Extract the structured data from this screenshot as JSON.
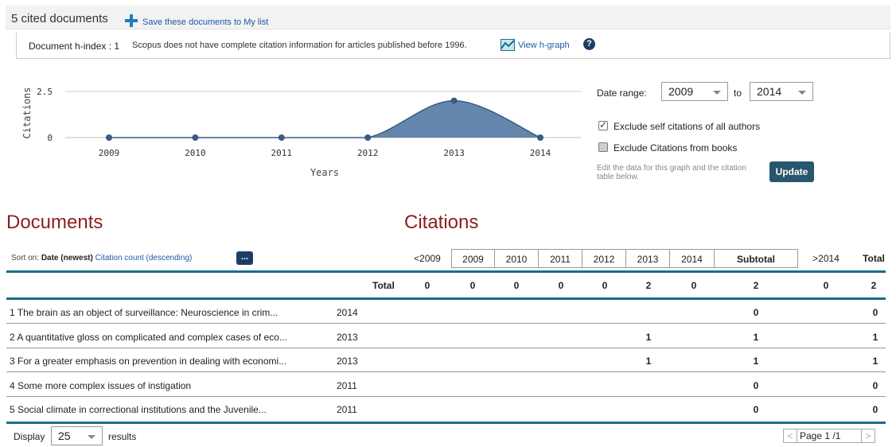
{
  "header": {
    "title": "5 cited documents",
    "save_label": "Save these documents to My list",
    "hindex_label": "Document h-index : 1",
    "hindex_note": "Scopus does not have complete citation information for articles published before 1996.",
    "view_hgraph": "View h-graph",
    "help": "?"
  },
  "chart_data": {
    "type": "area",
    "x": [
      "2009",
      "2010",
      "2011",
      "2012",
      "2013",
      "2014"
    ],
    "series": [
      {
        "values": [
          0,
          0,
          0,
          0,
          2,
          0
        ]
      }
    ],
    "xlabel": "Years",
    "ylabel": "Citations",
    "yticks": [
      "2.5",
      "0"
    ],
    "ylim": [
      0,
      2.5
    ],
    "fill_color": "#5d7fa8",
    "line_color": "#3b5a86"
  },
  "controls": {
    "date_range_label": "Date range:",
    "from_year": "2009",
    "to_label": "to",
    "to_year": "2014",
    "exclude_self_label": "Exclude self citations of all authors",
    "exclude_self_checked": true,
    "exclude_books_label": "Exclude Citations from books",
    "exclude_books_checked": false,
    "edit_note": "Edit the data for this graph and the citation table below.",
    "update_label": "Update"
  },
  "sections": {
    "documents": "Documents",
    "citations": "Citations"
  },
  "sort": {
    "prefix": "Sort on:",
    "current": "Date (newest)",
    "option": "Citation count (descending)",
    "more": "..."
  },
  "table": {
    "columns": [
      "<2009",
      "2009",
      "2010",
      "2011",
      "2012",
      "2013",
      "2014",
      "Subtotal",
      ">2014",
      "Total"
    ],
    "totals_label": "Total",
    "totals": [
      "0",
      "0",
      "0",
      "0",
      "0",
      "2",
      "0",
      "2",
      "0",
      "2"
    ],
    "rows": [
      {
        "title": "1 The brain as an object of surveillance: Neuroscience in crim...",
        "year": "2014",
        "cells": [
          "",
          "",
          "",
          "",
          "",
          "",
          "",
          "0",
          "",
          "0"
        ]
      },
      {
        "title": "2 A quantitative gloss on complicated and complex cases of eco...",
        "year": "2013",
        "cells": [
          "",
          "",
          "",
          "",
          "",
          "1",
          "",
          "1",
          "",
          "1"
        ]
      },
      {
        "title": "3 For a greater emphasis on prevention in dealing with economi...",
        "year": "2013",
        "cells": [
          "",
          "",
          "",
          "",
          "",
          "1",
          "",
          "1",
          "",
          "1"
        ]
      },
      {
        "title": "4 Some more complex issues of instigation",
        "year": "2011",
        "cells": [
          "",
          "",
          "",
          "",
          "",
          "",
          "",
          "0",
          "",
          "0"
        ]
      },
      {
        "title": "5 Social climate in correctional institutions and the Juvenile...",
        "year": "2011",
        "cells": [
          "",
          "",
          "",
          "",
          "",
          "",
          "",
          "0",
          "",
          "0"
        ]
      }
    ]
  },
  "footer": {
    "display_label": "Display",
    "display_value": "25",
    "results_label": "results",
    "prev": "<",
    "page_text": "Page 1   /1",
    "next": ">"
  }
}
